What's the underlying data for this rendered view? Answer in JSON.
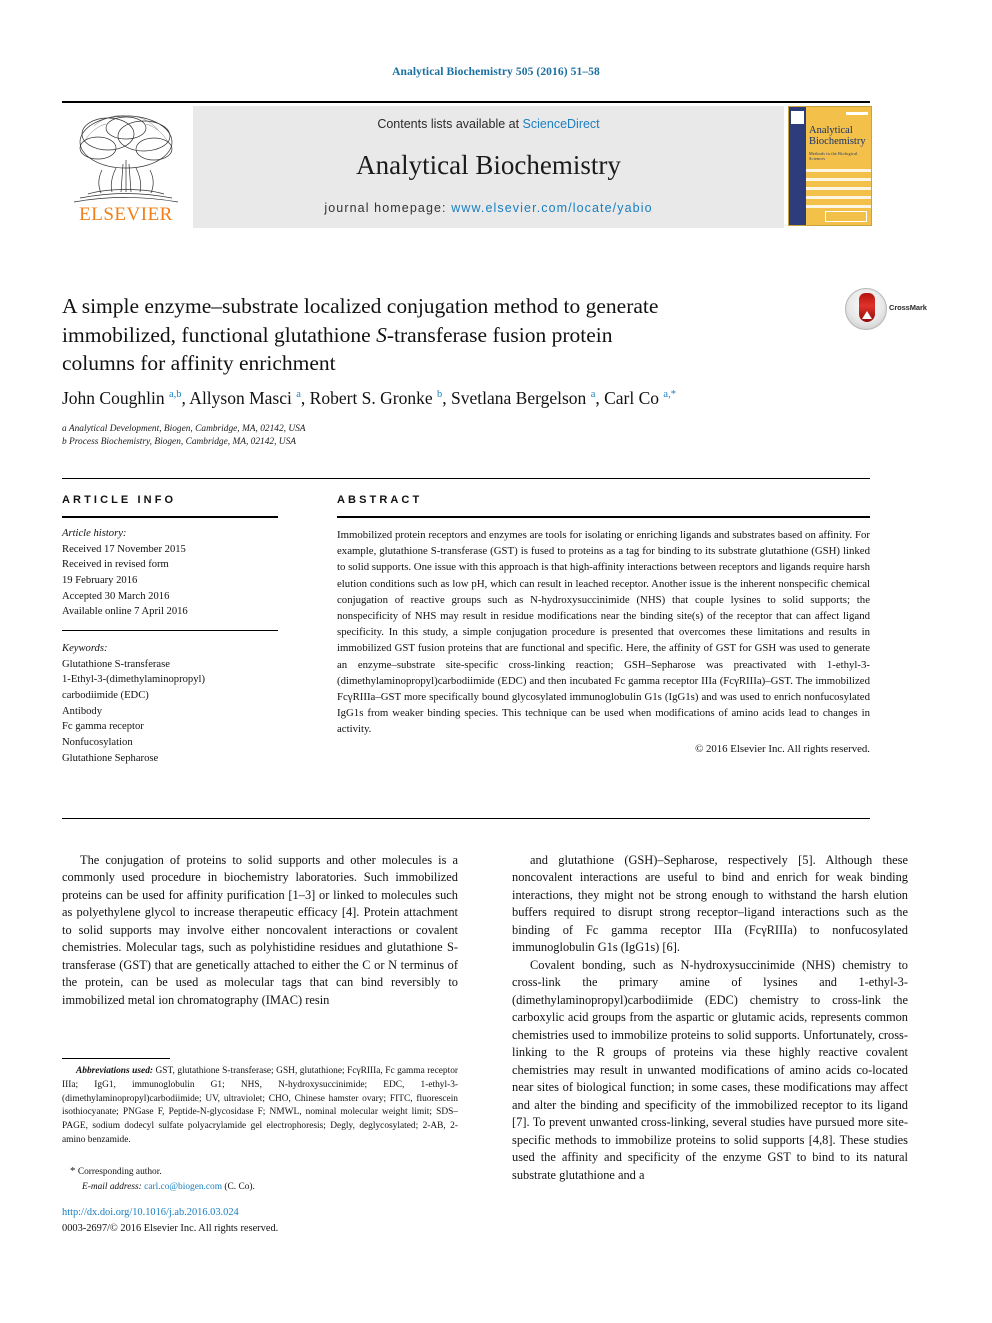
{
  "running_head": "Analytical Biochemistry 505 (2016) 51–58",
  "masthead": {
    "contents_line": "Contents lists available at ",
    "sciencedirect": "ScienceDirect",
    "journal_name": "Analytical Biochemistry",
    "homepage_label": "journal homepage: ",
    "homepage_url": "www.elsevier.com/locate/yabio",
    "publisher": "ELSEVIER",
    "cover": {
      "title": "Analytical Biochemistry",
      "subtitle": "Methods in the Biological Sciences"
    }
  },
  "article": {
    "title_line1": "A simple enzyme–substrate localized conjugation method to generate",
    "title_line2_a": "immobilized, functional glutathione ",
    "title_line2_italic": "S",
    "title_line2_b": "-transferase fusion protein",
    "title_line3": "columns for affinity enrichment",
    "crossmark_label": "CrossMark",
    "authors": "John Coughlin a,b, Allyson Masci a, Robert S. Gronke b, Svetlana Bergelson a, Carl Co a,*",
    "affiliation_a": "a Analytical Development, Biogen, Cambridge, MA, 02142, USA",
    "affiliation_b": "b Process Biochemistry, Biogen, Cambridge, MA, 02142, USA"
  },
  "article_info": {
    "heading": "ARTICLE INFO",
    "history_label": "Article history:",
    "history": [
      "Received 17 November 2015",
      "Received in revised form",
      "19 February 2016",
      "Accepted 30 March 2016",
      "Available online 7 April 2016"
    ],
    "keywords_label": "Keywords:",
    "keywords": [
      "Glutathione S-transferase",
      "1-Ethyl-3-(dimethylaminopropyl)",
      "carbodiimide (EDC)",
      "Antibody",
      "Fc gamma receptor",
      "Nonfucosylation",
      "Glutathione Sepharose"
    ]
  },
  "abstract": {
    "heading": "ABSTRACT",
    "text": "Immobilized protein receptors and enzymes are tools for isolating or enriching ligands and substrates based on affinity. For example, glutathione S-transferase (GST) is fused to proteins as a tag for binding to its substrate glutathione (GSH) linked to solid supports. One issue with this approach is that high-affinity interactions between receptors and ligands require harsh elution conditions such as low pH, which can result in leached receptor. Another issue is the inherent nonspecific chemical conjugation of reactive groups such as N-hydroxysuccinimide (NHS) that couple lysines to solid supports; the nonspecificity of NHS may result in residue modifications near the binding site(s) of the receptor that can affect ligand specificity. In this study, a simple conjugation procedure is presented that overcomes these limitations and results in immobilized GST fusion proteins that are functional and specific. Here, the affinity of GST for GSH was used to generate an enzyme–substrate site-specific cross-linking reaction; GSH–Sepharose was preactivated with 1-ethyl-3-(dimethylaminopropyl)carbodiimide (EDC) and then incubated Fc gamma receptor IIIa (FcγRIIIa)–GST. The immobilized FcγRIIIa–GST more specifically bound glycosylated immunoglobulin G1s (IgG1s) and was used to enrich nonfucosylated IgG1s from weaker binding species. This technique can be used when modifications of amino acids lead to changes in activity.",
    "copyright": "© 2016 Elsevier Inc. All rights reserved."
  },
  "body": {
    "left_paragraph_1": "The conjugation of proteins to solid supports and other molecules is a commonly used procedure in biochemistry laboratories. Such immobilized proteins can be used for affinity purification [1–3] or linked to molecules such as polyethylene glycol to increase therapeutic efficacy [4]. Protein attachment to solid supports may involve either noncovalent interactions or covalent chemistries. Molecular tags, such as polyhistidine residues and glutathione S-transferase (GST) that are genetically attached to either the C or N terminus of the protein, can be used as molecular tags that can bind reversibly to immobilized metal ion chromatography (IMAC) resin",
    "right_paragraph_1": "and glutathione (GSH)–Sepharose, respectively [5]. Although these noncovalent interactions are useful to bind and enrich for weak binding interactions, they might not be strong enough to withstand the harsh elution buffers required to disrupt strong receptor–ligand interactions such as the binding of Fc gamma receptor IIIa (FcγRIIIa) to nonfucosylated immunoglobulin G1s (IgG1s) [6].",
    "right_paragraph_2": "Covalent bonding, such as N-hydroxysuccinimide (NHS) chemistry to cross-link the primary amine of lysines and 1-ethyl-3-(dimethylaminopropyl)carbodiimide (EDC) chemistry to cross-link the carboxylic acid groups from the aspartic or glutamic acids, represents common chemistries used to immobilize proteins to solid supports. Unfortunately, cross-linking to the R groups of proteins via these highly reactive covalent chemistries may result in unwanted modifications of amino acids co-located near sites of biological function; in some cases, these modifications may affect and alter the binding and specificity of the immobilized receptor to its ligand [7]. To prevent unwanted cross-linking, several studies have pursued more site-specific methods to immobilize proteins to solid supports [4,8]. These studies used the affinity and specificity of the enzyme GST to bind to its natural substrate glutathione and a"
  },
  "footnote": {
    "abbrev_lead": "Abbreviations used:",
    "abbrev_text": " GST, glutathione S-transferase; GSH, glutathione; FcγRIIIa, Fc gamma receptor IIIa; IgG1, immunoglobulin G1; NHS, N-hydroxysuccinimide; EDC, 1-ethyl-3-(dimethylaminopropyl)carbodiimide; UV, ultraviolet; CHO, Chinese hamster ovary; FITC, fluorescein isothiocyanate; PNGase F, Peptide-N-glycosidase F; NMWL, nominal molecular weight limit; SDS–PAGE, sodium dodecyl sulfate polyacrylamide gel electrophoresis; Degly, deglycosylated; 2-AB, 2-amino benzamide.",
    "corresponding": "Corresponding author.",
    "email_label": "E-mail address:",
    "email": "carl.co@biogen.com",
    "email_suffix": "(C. Co)."
  },
  "footer": {
    "doi": "http://dx.doi.org/10.1016/j.ab.2016.03.024",
    "issn_copyright": "0003-2697/© 2016 Elsevier Inc. All rights reserved."
  },
  "colors": {
    "link": "#1a7fc1",
    "elsevier_orange": "#f07f1a",
    "cover_yellow": "#f3c14a",
    "cover_blue": "#2d3c7a"
  }
}
